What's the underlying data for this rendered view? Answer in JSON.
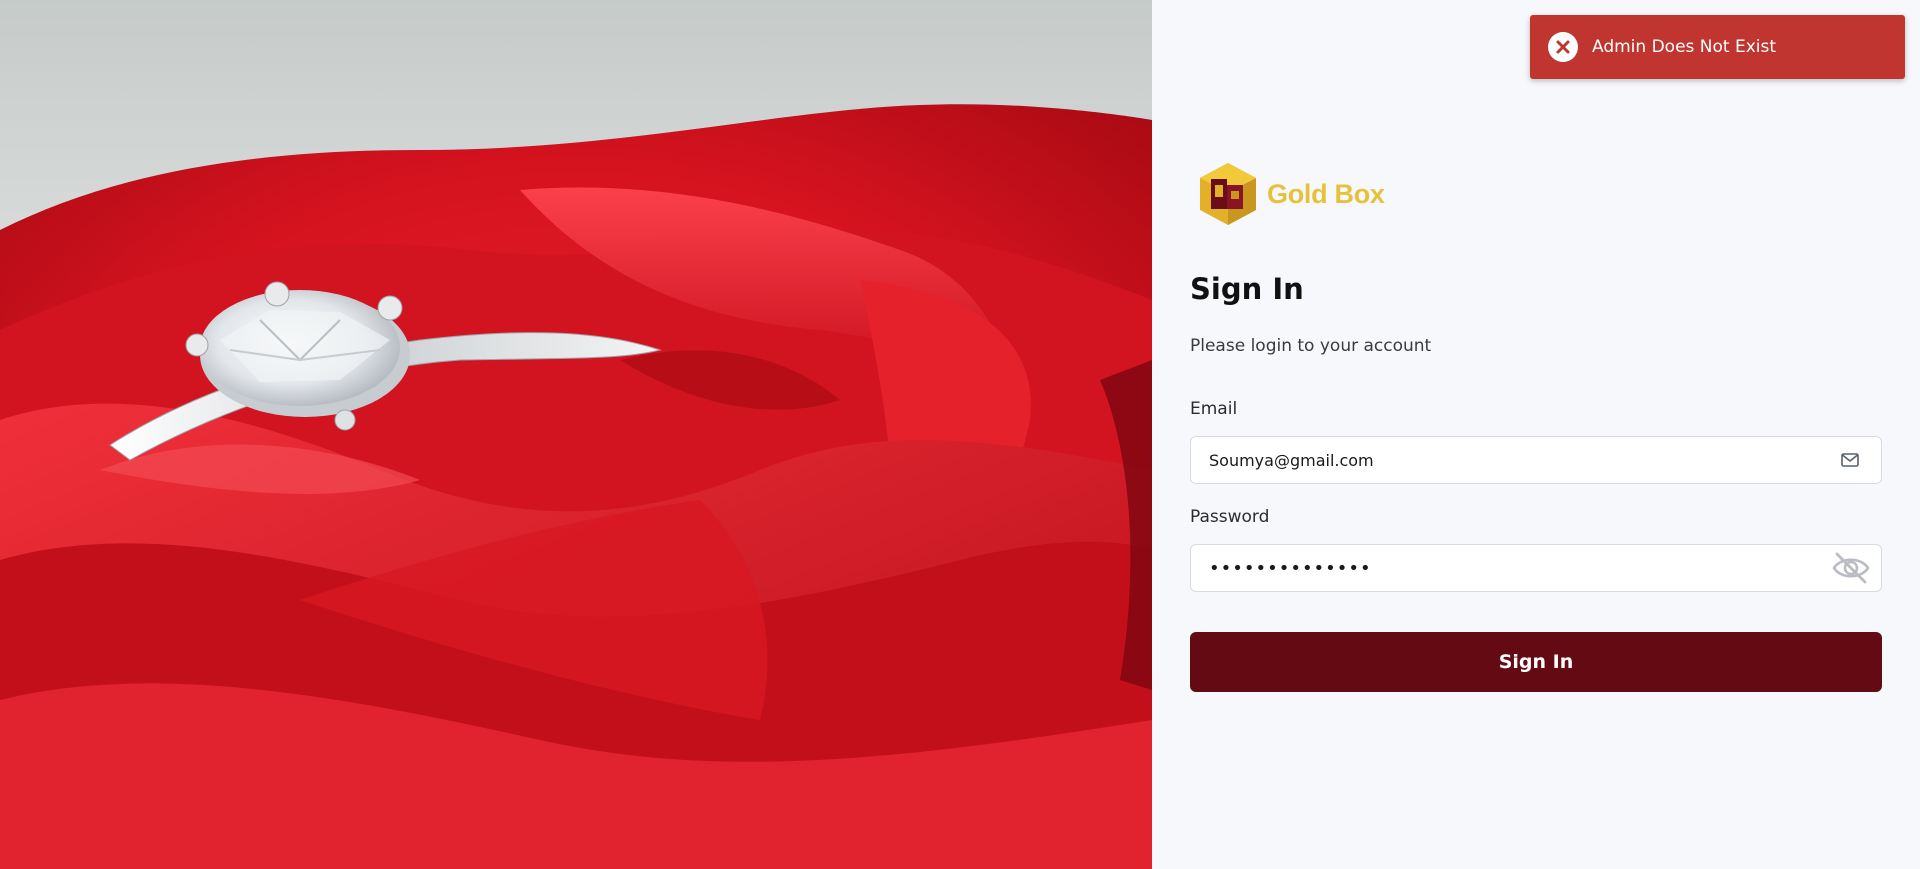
{
  "toast": {
    "message": "Admin Does Not Exist",
    "icon": "error-x-icon",
    "color": "#c0352f"
  },
  "brand": {
    "name": "Gold Box",
    "logo_icon": "gold-box-logo-icon",
    "color": "#e6c23b"
  },
  "signin": {
    "title": "Sign In",
    "subtitle": "Please login to your account",
    "email": {
      "label": "Email",
      "value": "Soumya@gmail.com",
      "icon": "mail-icon"
    },
    "password": {
      "label": "Password",
      "value": "••••••••••••••",
      "icon": "eye-off-icon"
    },
    "button_label": "Sign In",
    "button_color": "#630a13"
  },
  "hero": {
    "image": "ring-on-red-rose-photo"
  }
}
